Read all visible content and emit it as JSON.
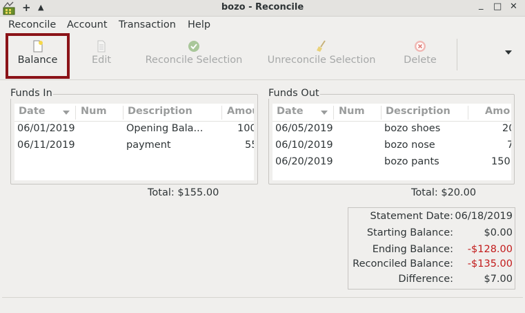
{
  "window": {
    "title": "bozo - Reconcile",
    "plus_glyph": "+",
    "up_glyph": "▲",
    "minimize_glyph": "_",
    "maximize_glyph": "□",
    "close_glyph": "✕"
  },
  "menu": [
    "Reconcile",
    "Account",
    "Transaction",
    "Help"
  ],
  "toolbar": {
    "balance": "Balance",
    "edit": "Edit",
    "reconcile_selection": "Reconcile Selection",
    "unreconcile_selection": "Unreconcile Selection",
    "delete": "Delete"
  },
  "funds_in": {
    "label": "Funds In",
    "columns": [
      "Date",
      "Num",
      "Description",
      "Amou"
    ],
    "rows": [
      {
        "date": "06/01/2019",
        "num": "",
        "description": "Opening Bala...",
        "amount": "100"
      },
      {
        "date": "06/11/2019",
        "num": "",
        "description": "payment",
        "amount": "55"
      }
    ],
    "total": "Total: $155.00"
  },
  "funds_out": {
    "label": "Funds Out",
    "columns": [
      "Date",
      "Num",
      "Description",
      "Amo"
    ],
    "rows": [
      {
        "date": "06/05/2019",
        "num": "",
        "description": "bozo shoes",
        "amount": "20"
      },
      {
        "date": "06/10/2019",
        "num": "",
        "description": "bozo nose",
        "amount": "7"
      },
      {
        "date": "06/20/2019",
        "num": "",
        "description": "bozo pants",
        "amount": "150"
      }
    ],
    "total": "Total: $20.00"
  },
  "summary": {
    "statement_date_label": "Statement Date:",
    "statement_date": "06/18/2019",
    "starting_balance_label": "Starting Balance:",
    "starting_balance": "$0.00",
    "ending_balance_label": "Ending Balance:",
    "ending_balance": "-$128.00",
    "reconciled_balance_label": "Reconciled Balance:",
    "reconciled_balance": "-$135.00",
    "difference_label": "Difference:",
    "difference": "$7.00"
  },
  "colors": {
    "highlight": "#8b1318",
    "negative": "#c21a1a"
  }
}
